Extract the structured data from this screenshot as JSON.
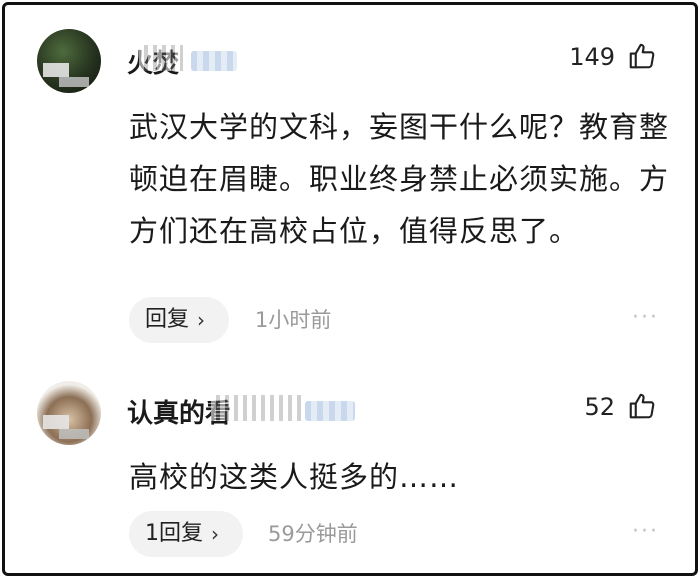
{
  "comments": [
    {
      "username": "火焚",
      "likes": "149",
      "text": "武汉大学的文科，妄图干什么呢？教育整顿迫在眉睫。职业终身禁止必须实施。方方们还在高校占位，值得反思了。",
      "reply_label": "回复",
      "timestamp": "1小时前"
    },
    {
      "username": "认真的看",
      "likes": "52",
      "text": "高校的这类人挺多的……",
      "reply_label": "1回复",
      "timestamp": "59分钟前"
    }
  ],
  "icons": {
    "like": "thumbs-up-icon",
    "more": "more-dots-icon",
    "chevron": "chevron-right-icon"
  },
  "colors": {
    "text": "#1a1a1a",
    "muted": "#9a9a9a",
    "pill": "#f2f2f2"
  }
}
